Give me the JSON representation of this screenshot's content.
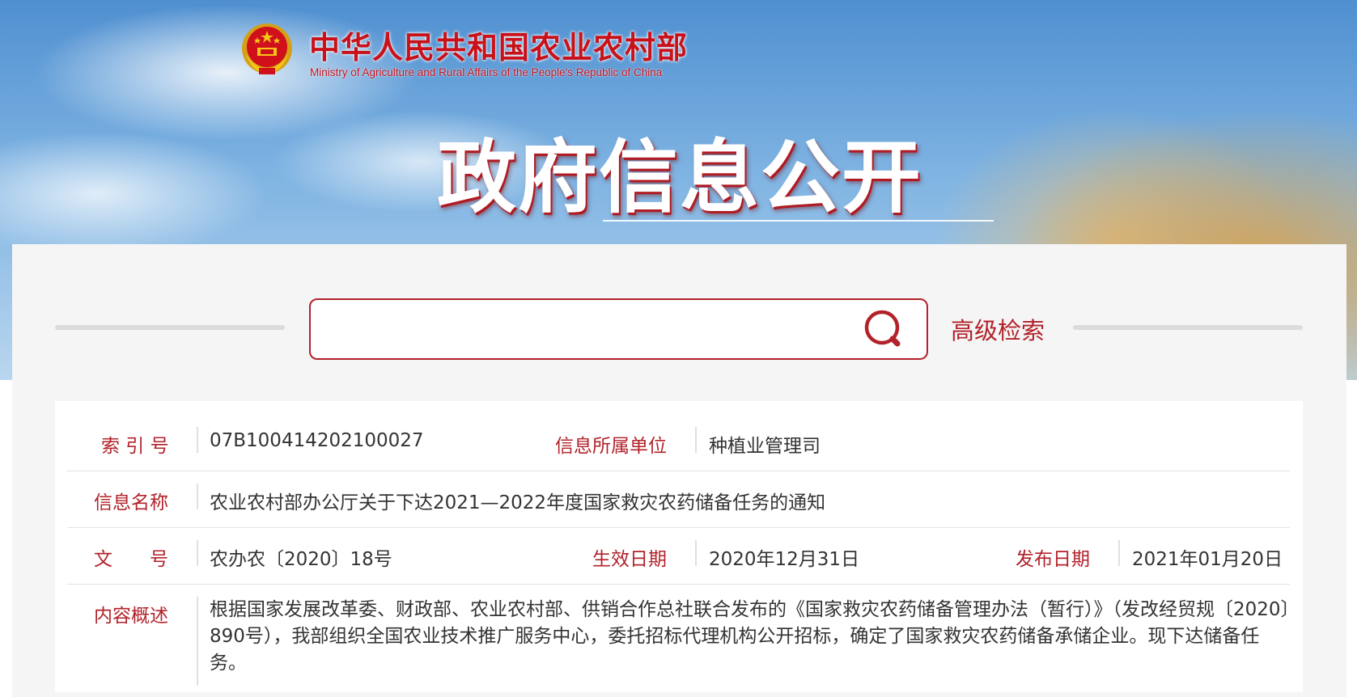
{
  "header": {
    "site_title": "中华人民共和国农业农村部",
    "site_subtitle": "Ministry of Agriculture and Rural Affairs of the People's Republic of China",
    "section_title": "政府信息公开"
  },
  "search": {
    "value": "",
    "placeholder": "",
    "advanced_label": "高级检索"
  },
  "info": {
    "index_label": "索 引 号",
    "index_value": "07B100414202100027",
    "unit_label": "信息所属单位",
    "unit_value": "种植业管理司",
    "name_label": "信息名称",
    "name_value": "农业农村部办公厅关于下达2021—2022年度国家救灾农药储备任务的通知",
    "doc_label": "文　　号",
    "doc_value": "农办农〔2020〕18号",
    "effective_label": "生效日期",
    "effective_value": "2020年12月31日",
    "publish_label": "发布日期",
    "publish_value": "2021年01月20日",
    "summary_label": "内容概述",
    "summary_value": "根据国家发展改革委、财政部、农业农村部、供销合作总社联合发布的《国家救灾农药储备管理办法（暂行）》（发改经贸规〔2020〕890号），我部组织全国农业技术推广服务中心，委托招标代理机构公开招标，确定了国家救灾农药储备承储企业。现下达储备任务。"
  },
  "colors": {
    "brand_red": "#c8111a",
    "label_red": "#b2222a",
    "panel_bg": "#f5f5f5"
  }
}
